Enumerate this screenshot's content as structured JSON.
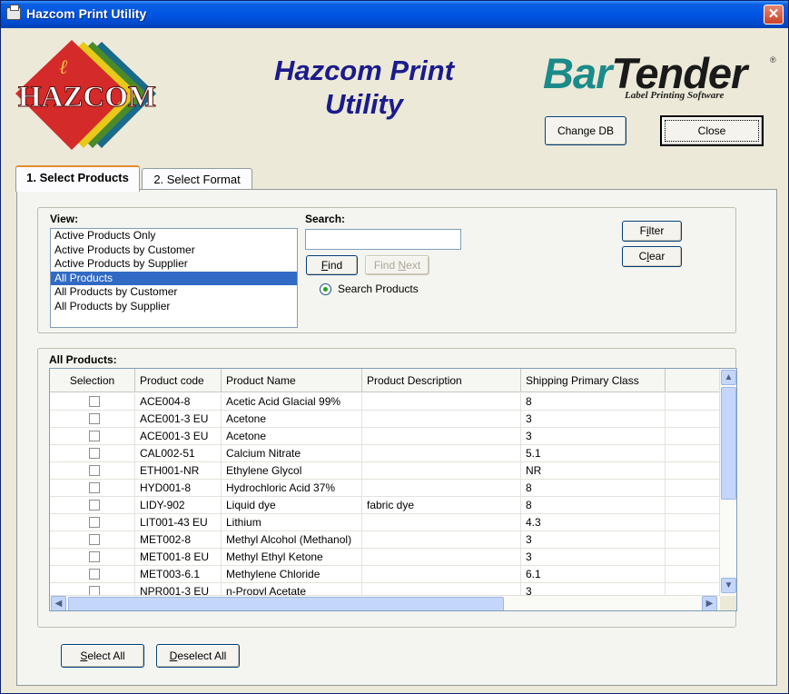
{
  "window": {
    "title": "Hazcom Print Utility",
    "close_glyph": "✕"
  },
  "header": {
    "hazcom_logo_text": "HAZCOM",
    "app_title_line1": "Hazcom Print",
    "app_title_line2": "Utility",
    "bartender_bar": "Bar",
    "bartender_tender": "Tender",
    "bartender_reg": "®",
    "bartender_sub": "Label Printing Software",
    "change_db": "Change DB",
    "close": "Close"
  },
  "tabs": [
    {
      "label": "1. Select Products"
    },
    {
      "label": "2. Select Format"
    }
  ],
  "view": {
    "label": "View:",
    "items": [
      "Active Products Only",
      "Active Products by Customer",
      "Active Products by Supplier",
      "All Products",
      "All Products by Customer",
      "All Products by Supplier"
    ],
    "selected": "All Products"
  },
  "search": {
    "label": "Search:",
    "value": "",
    "find_mnemonic": "F",
    "find_rest": "ind",
    "find_next_pre": "Find ",
    "find_next_mnemonic": "N",
    "find_next_rest": "ext",
    "radio_label": "Search Products"
  },
  "filter": {
    "filter_pre": "F",
    "filter_mnemonic": "i",
    "filter_rest": "lter",
    "clear_pre": "C",
    "clear_mnemonic": "l",
    "clear_rest": "ear"
  },
  "products": {
    "label": "All Products:",
    "columns": [
      "Selection",
      "Product code",
      "Product Name",
      "Product Description",
      "Shipping Primary Class"
    ],
    "rows": [
      {
        "code": "ACE004-8",
        "name": "Acetic Acid Glacial 99%",
        "desc": "",
        "class": "8"
      },
      {
        "code": "ACE001-3 EU",
        "name": "Acetone",
        "desc": "",
        "class": "3"
      },
      {
        "code": "ACE001-3 EU",
        "name": "Acetone",
        "desc": "",
        "class": "3"
      },
      {
        "code": "CAL002-51",
        "name": "Calcium Nitrate",
        "desc": "",
        "class": "5.1"
      },
      {
        "code": "ETH001-NR",
        "name": "Ethylene Glycol",
        "desc": "",
        "class": "NR"
      },
      {
        "code": "HYD001-8",
        "name": "Hydrochloric Acid 37%",
        "desc": "",
        "class": "8"
      },
      {
        "code": "LIDY-902",
        "name": "Liquid dye",
        "desc": "fabric dye",
        "class": "8"
      },
      {
        "code": "LIT001-43 EU",
        "name": "Lithium",
        "desc": "",
        "class": "4.3"
      },
      {
        "code": "MET002-8",
        "name": "Methyl Alcohol (Methanol)",
        "desc": "",
        "class": "3"
      },
      {
        "code": "MET001-8 EU",
        "name": "Methyl Ethyl Ketone",
        "desc": "",
        "class": "3"
      },
      {
        "code": "MET003-6.1",
        "name": "Methylene Chloride",
        "desc": "",
        "class": "6.1"
      },
      {
        "code": "NPR001-3 EU",
        "name": "n-Propyl Acetate",
        "desc": "",
        "class": "3"
      }
    ]
  },
  "footer": {
    "select_all_mnemonic": "S",
    "select_all_rest": "elect All",
    "deselect_all_mnemonic": "D",
    "deselect_all_rest": "eselect All"
  },
  "colors": {
    "titlebar": "#0055e5",
    "selection": "#316ac5",
    "app_title": "#1b1b8c",
    "bartender_accent": "#1b8a8a"
  }
}
